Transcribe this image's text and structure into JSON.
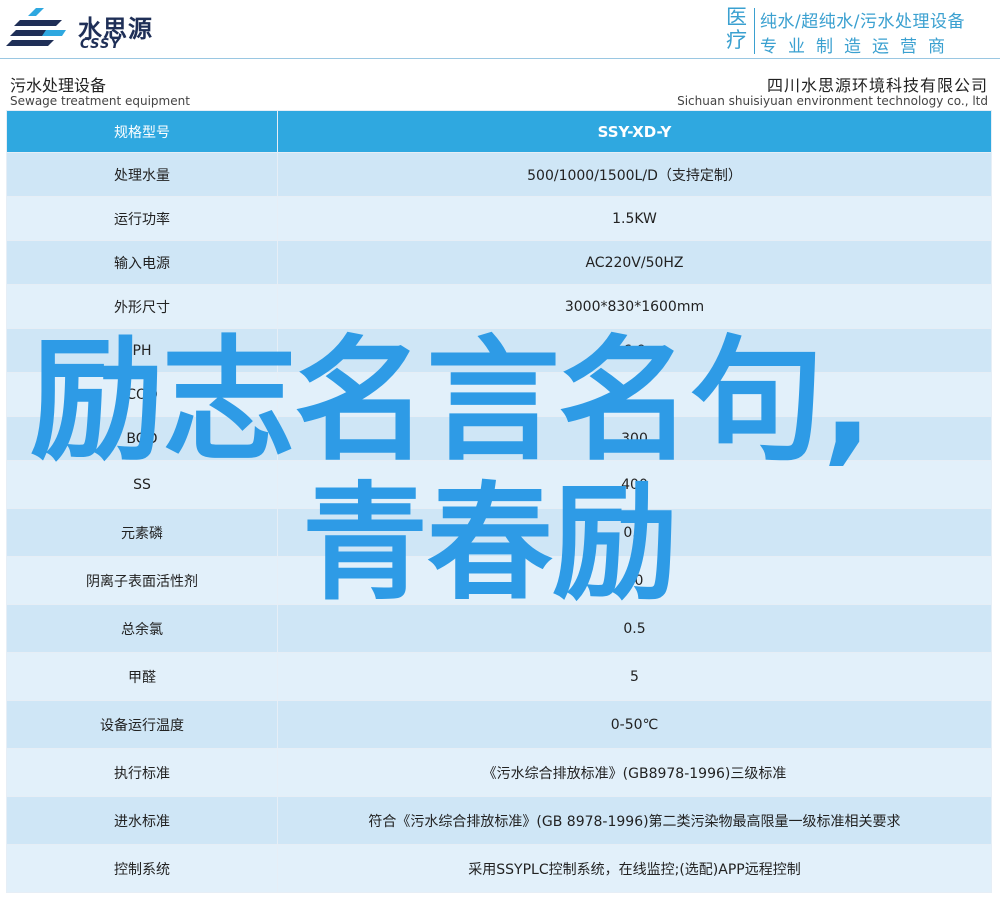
{
  "header": {
    "logo_cn": "水思源",
    "logo_en": "CSSY",
    "category": "医疗",
    "tagline_1": "纯水/超纯水/污水处理设备",
    "tagline_2": "专业制造运营商"
  },
  "subheader": {
    "title_cn": "污水处理设备",
    "title_en": "Sewage treatment equipment",
    "company_cn": "四川水思源环境科技有限公司",
    "company_en": "Sichuan shuisiyuan environment technology co., ltd"
  },
  "table": {
    "header": {
      "label": "规格型号",
      "value": "SSY-XD-Y"
    },
    "rows": [
      {
        "label": "处理水量",
        "value": "500/1000/1500L/D（支持定制）"
      },
      {
        "label": "运行功率",
        "value": "1.5KW"
      },
      {
        "label": "输入电源",
        "value": "AC220V/50HZ"
      },
      {
        "label": "外形尺寸",
        "value": "3000*830*1600mm"
      },
      {
        "label": "PH",
        "value": "6-9"
      },
      {
        "label": "COD",
        "value": ""
      },
      {
        "label": "BOD",
        "value": "300"
      },
      {
        "label": "SS",
        "value": "400"
      },
      {
        "label": "元素磷",
        "value": "0.8"
      },
      {
        "label": "阴离子表面活性剂",
        "value": "20"
      },
      {
        "label": "总余氯",
        "value": "0.5"
      },
      {
        "label": "甲醛",
        "value": "5"
      },
      {
        "label": "设备运行温度",
        "value": "0-50℃"
      },
      {
        "label": "执行标准",
        "value": "《污水综合排放标准》(GB8978-1996)三级标准"
      },
      {
        "label": "进水标准",
        "value": "符合《污水综合排放标准》(GB 8978-1996)第二类污染物最高限量一级标准相关要求"
      },
      {
        "label": "控制系统",
        "value": "采用SSYPLC控制系统，在线监控;(选配)APP远程控制"
      }
    ]
  },
  "overlay": {
    "line1": "励志名言名句,",
    "line2": "青春励"
  },
  "colors": {
    "brand_dark": "#1f2f57",
    "accent_blue": "#3aa0d0",
    "table_head": "#2fa8e0",
    "row_light": "#e2f0fa",
    "row_dark": "#cfe6f6",
    "overlay_blue": "#2e9be6"
  }
}
